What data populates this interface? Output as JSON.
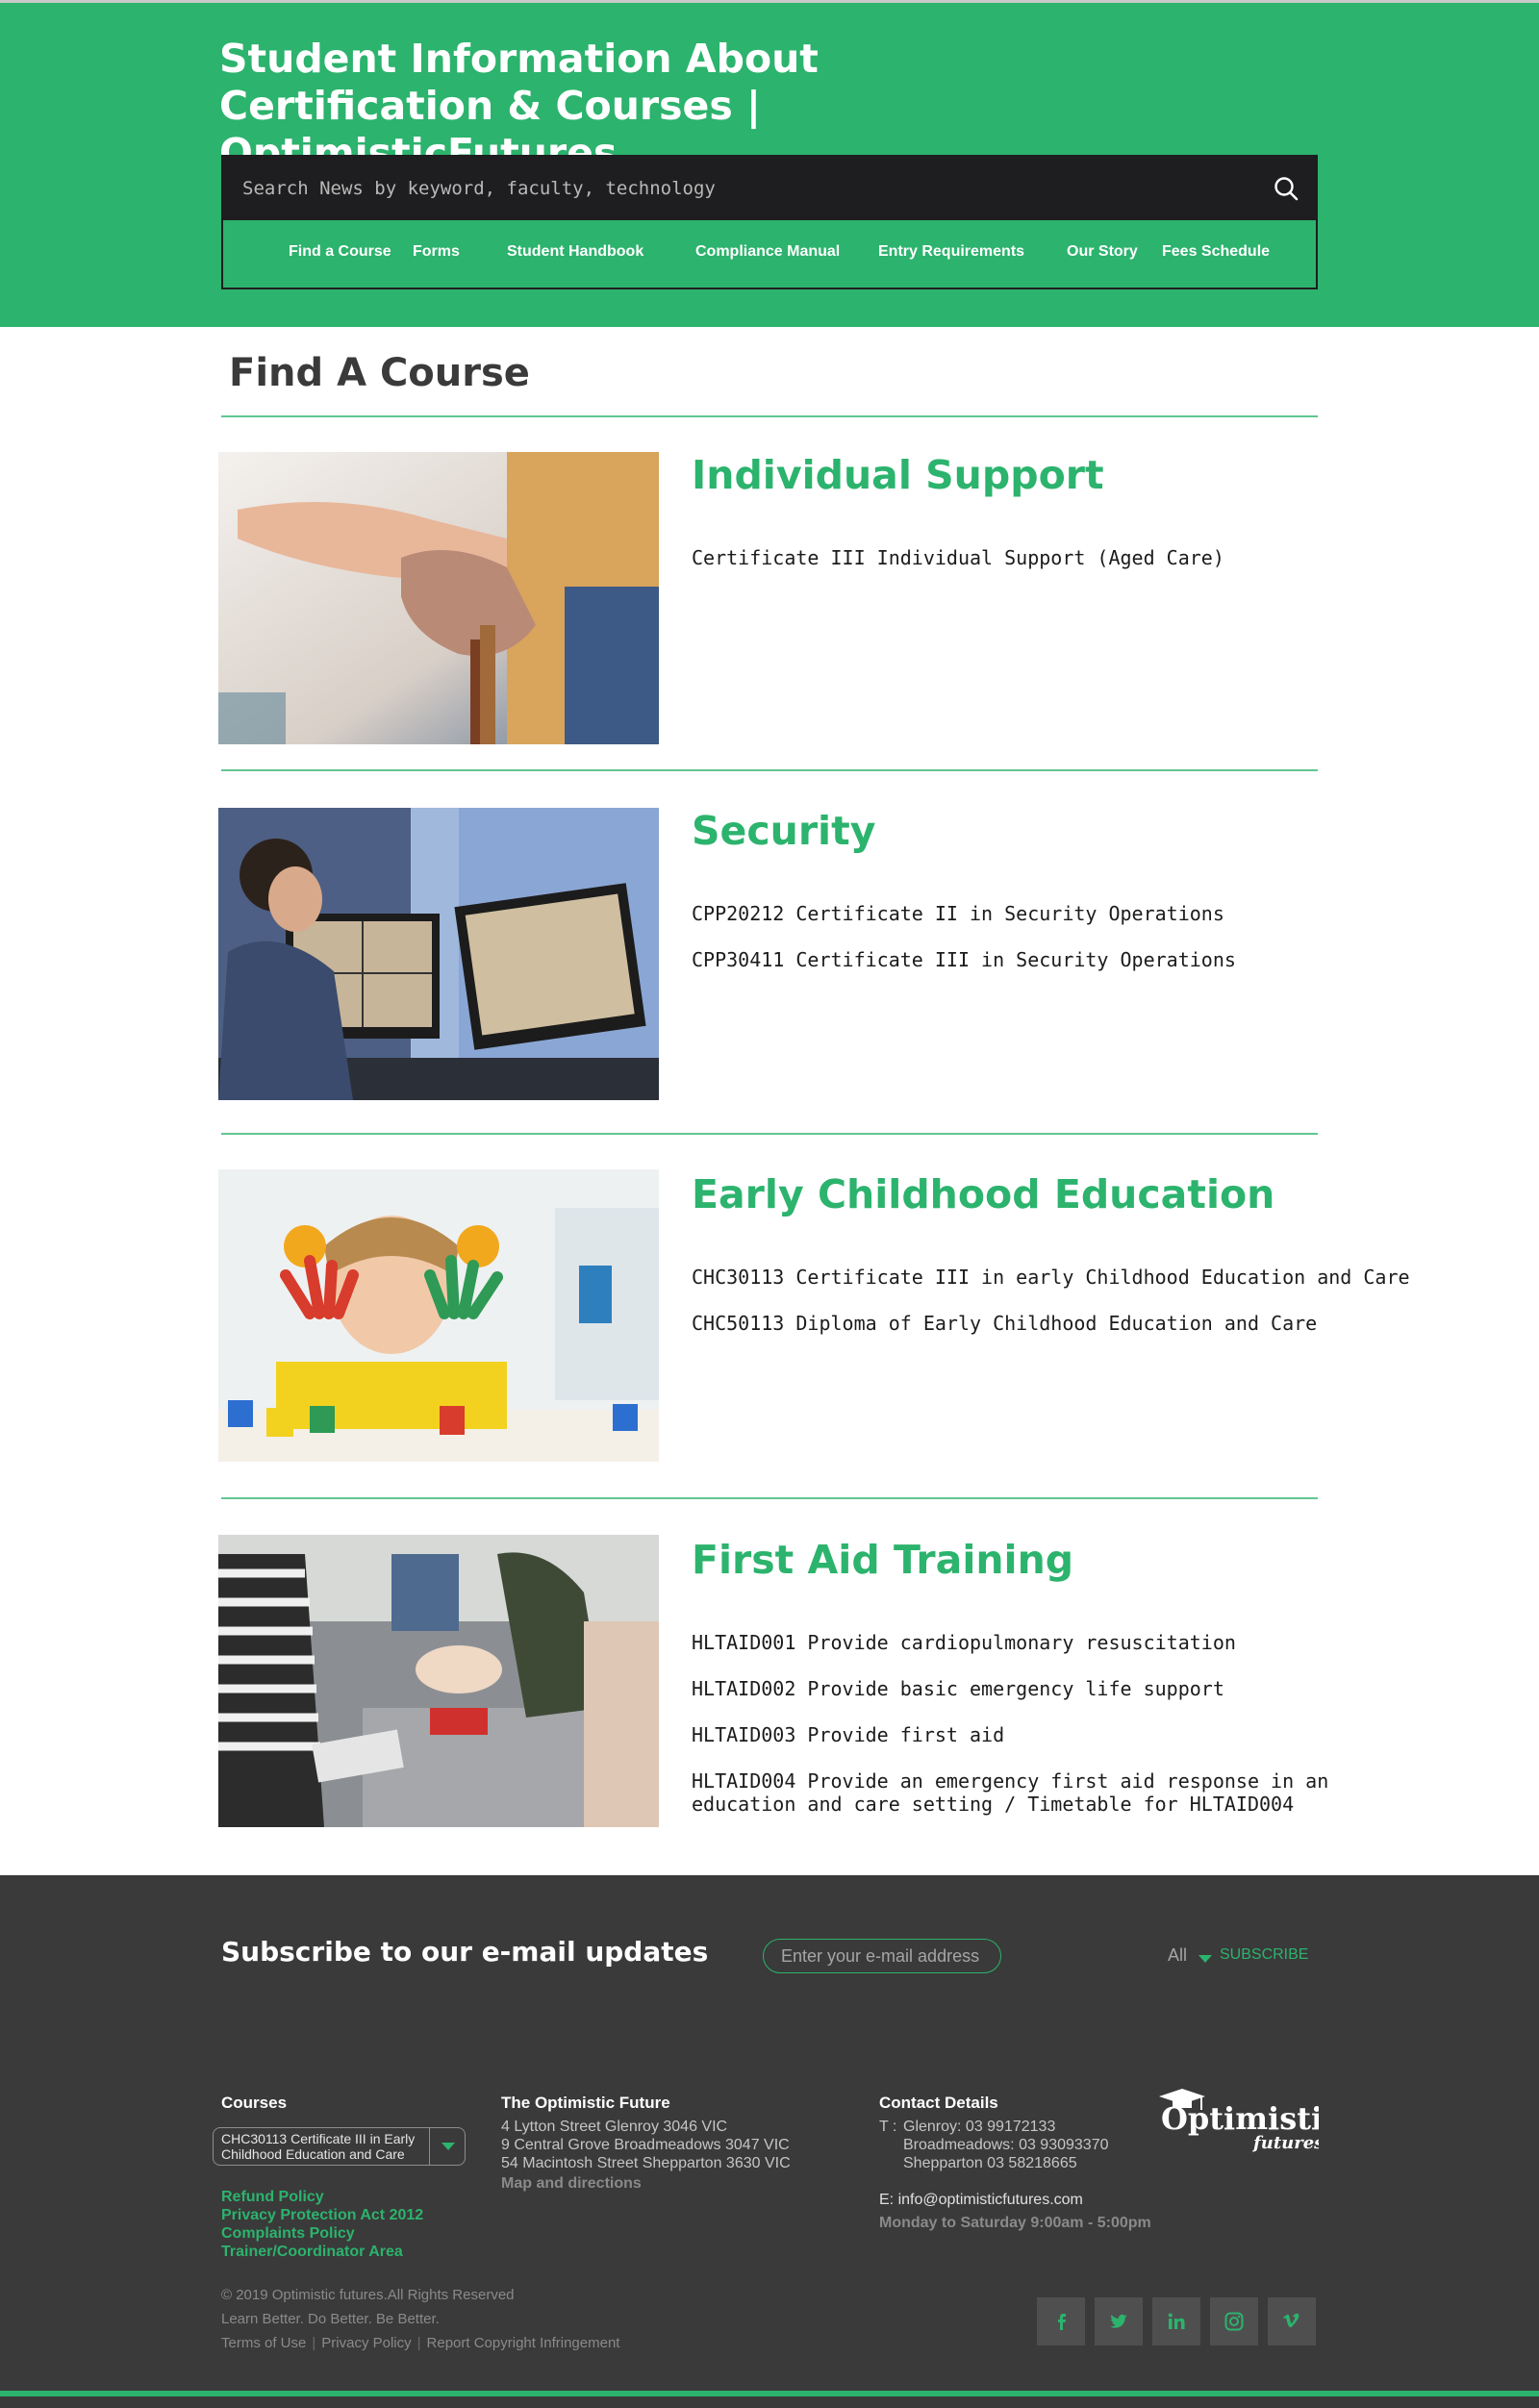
{
  "header": {
    "title": "Student Information About Certification & Courses | OptimisticFutures",
    "search": {
      "placeholder": "Search News by keyword, faculty, technology",
      "icon": "search-icon"
    },
    "nav": [
      {
        "label": "Find a Course"
      },
      {
        "label": "Forms"
      },
      {
        "label": "Student Handbook"
      },
      {
        "label": "Compliance Manual"
      },
      {
        "label": "Entry Requirements"
      },
      {
        "label": "Our Story"
      },
      {
        "label": "Fees Schedule"
      }
    ]
  },
  "main": {
    "page_title": "Find A Course",
    "courses": [
      {
        "title": "Individual Support",
        "items": [
          "Certificate III Individual Support (Aged Care)"
        ]
      },
      {
        "title": "Security",
        "items": [
          "CPP20212 Certificate II in Security Operations",
          "CPP30411 Certificate III in Security Operations"
        ]
      },
      {
        "title": "Early Childhood Education",
        "items": [
          "CHC30113 Certificate III in early Childhood Education and Care",
          "CHC50113 Diploma of Early Childhood Education and Care"
        ]
      },
      {
        "title": "First Aid Training",
        "items": [
          "HLTAID001 Provide cardiopulmonary resuscitation",
          "HLTAID002 Provide basic emergency life support",
          "HLTAID003 Provide first aid",
          "HLTAID004 Provide an emergency first aid response in an education and care setting / Timetable for HLTAID004"
        ]
      }
    ]
  },
  "footer": {
    "subscribe": {
      "title": "Subscribe to our e-mail updates",
      "email_placeholder": "Enter your e-mail address",
      "filter_value": "All",
      "button": "SUBSCRIBE"
    },
    "courses": {
      "heading": "Courses",
      "selected": "CHC30113 Certificate III in Early Childhood Education and Care",
      "links": [
        "Refund Policy",
        "Privacy Protection Act 2012",
        "Complaints Policy",
        "Trainer/Coordinator Area"
      ]
    },
    "optimistic": {
      "heading": "The Optimistic Future",
      "addresses": [
        "4 Lytton Street Glenroy 3046 VIC",
        "9 Central Grove Broadmeadows 3047 VIC",
        "54 Macintosh Street Shepparton 3630 VIC"
      ],
      "map_link": "Map and directions"
    },
    "contact": {
      "heading": "Contact Details",
      "phone_prefix": "T :",
      "phones": [
        "Glenroy: 03 99172133",
        "Broadmeadows: 03 93093370",
        "Shepparton 03 58218665"
      ],
      "email": "E: info@optimisticfutures.com",
      "hours": "Monday to Saturday 9:00am - 5:00pm"
    },
    "logo": {
      "word": "Optimistic",
      "sub": "futures"
    },
    "copyright": "© 2019 Optimistic futures.All Rights Reserved",
    "tagline": "Learn Better. Do Better. Be Better.",
    "legal": [
      "Terms of Use",
      "Privacy Policy",
      "Report Copyright Infringement"
    ],
    "social": [
      "facebook-icon",
      "twitter-icon",
      "linkedin-icon",
      "instagram-icon",
      "vimeo-icon"
    ]
  },
  "colors": {
    "brand_green": "#2cb36d",
    "footer_bg": "#3a3a3a",
    "search_bg": "#1e1e20"
  }
}
